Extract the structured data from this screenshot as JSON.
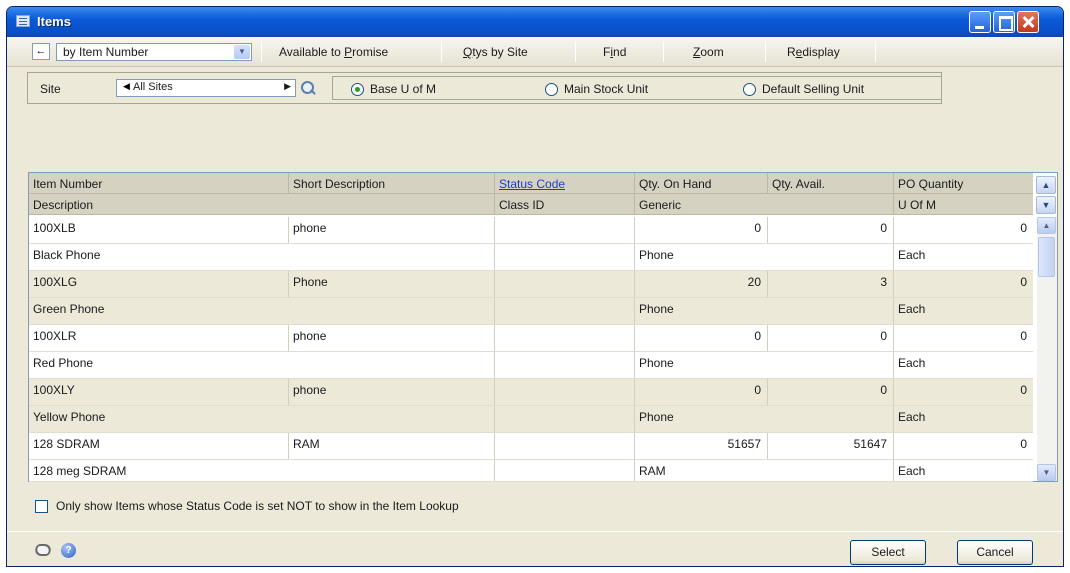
{
  "window": {
    "title": "Items"
  },
  "toolbar": {
    "nav_arrow": "←",
    "sort_by": "by Item Number",
    "available_to_promise": {
      "pre": "Available to ",
      "key": "P",
      "post": "romise"
    },
    "qtys_by_site": {
      "pre": "",
      "key": "Q",
      "post": "tys by Site"
    },
    "find": {
      "pre": "F",
      "key": "i",
      "post": "nd"
    },
    "zoom": {
      "pre": "",
      "key": "Z",
      "post": "oom"
    },
    "redisplay": {
      "pre": "R",
      "key": "e",
      "post": "display"
    }
  },
  "site": {
    "label": "Site",
    "value": "All Sites",
    "radios": [
      {
        "label": "Base U of M",
        "selected": true
      },
      {
        "label": "Main Stock Unit",
        "selected": false
      },
      {
        "label": "Default Selling Unit",
        "selected": false
      }
    ]
  },
  "grid": {
    "header1": [
      "Item Number",
      "Short Description",
      "Status Code",
      "Qty. On Hand",
      "Qty. Avail.",
      "PO Quantity"
    ],
    "header2": [
      "Description",
      "",
      "Class ID",
      "Generic",
      "",
      "U Of M"
    ],
    "rows": [
      {
        "item_number": "100XLB",
        "short_desc": "phone",
        "status": "",
        "on_hand": "0",
        "avail": "0",
        "po_qty": "0",
        "description": "Black Phone",
        "class_id": "",
        "generic": "Phone",
        "uofm": "Each"
      },
      {
        "item_number": "100XLG",
        "short_desc": "Phone",
        "status": "",
        "on_hand": "20",
        "avail": "3",
        "po_qty": "0",
        "description": "Green Phone",
        "class_id": "",
        "generic": "Phone",
        "uofm": "Each"
      },
      {
        "item_number": "100XLR",
        "short_desc": "phone",
        "status": "",
        "on_hand": "0",
        "avail": "0",
        "po_qty": "0",
        "description": "Red Phone",
        "class_id": "",
        "generic": "Phone",
        "uofm": "Each"
      },
      {
        "item_number": "100XLY",
        "short_desc": "phone",
        "status": "",
        "on_hand": "0",
        "avail": "0",
        "po_qty": "0",
        "description": "Yellow Phone",
        "class_id": "",
        "generic": "Phone",
        "uofm": "Each"
      },
      {
        "item_number": "128 SDRAM",
        "short_desc": "RAM",
        "status": "",
        "on_hand": "51657",
        "avail": "51647",
        "po_qty": "0",
        "description": "128 meg SDRAM",
        "class_id": "",
        "generic": "RAM",
        "uofm": "Each"
      }
    ]
  },
  "filter": {
    "label": "Only show Items whose Status Code is set NOT to show in the Item Lookup"
  },
  "buttons": {
    "select": "Select",
    "cancel": "Cancel"
  },
  "icons": {
    "help": "?"
  }
}
